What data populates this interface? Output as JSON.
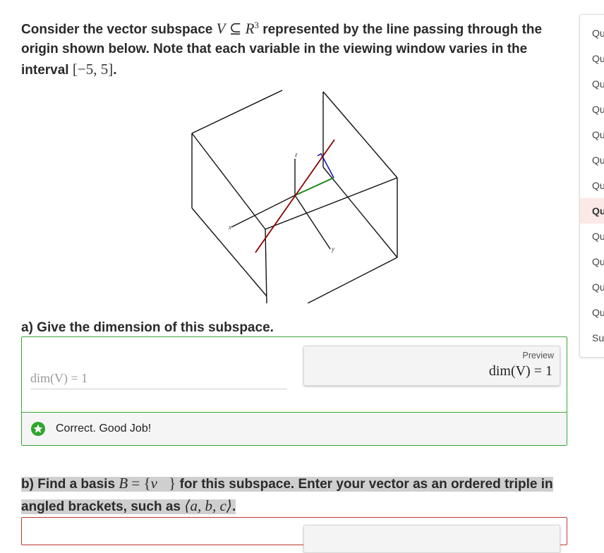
{
  "problem": {
    "t1": "Consider the vector subspace ",
    "m_V": "V",
    "m_subset": " ⊆ ",
    "m_R": "R",
    "m_exp": "3",
    "t2": " represented by the line passing through the origin shown below. Note that each variable in the viewing window varies in the interval ",
    "m_interval": "[−5, 5]",
    "t3": "."
  },
  "figure": {
    "axis_labels": {
      "x": "x",
      "y": "y",
      "z": "z"
    },
    "colors": {
      "frame": "#111111",
      "line": "#8b0000",
      "green": "#1a8a1a",
      "blue": "#1a1aa8"
    }
  },
  "part_a": {
    "label": "a) Give the dimension of this subspace.",
    "input_value": "dim(V) = 1",
    "preview_label": "Preview",
    "preview_value": "dim(V) = 1",
    "feedback": "Correct. Good Job!",
    "status_color": "#3aa53a"
  },
  "part_b": {
    "t1": "b) Find a basis ",
    "m_B": "B",
    "m_eq": " = {",
    "m_v": "v⃗",
    "m_close": "}",
    "t2": " for this subspace. Enter your vector as an ordered triple in angled brackets, such as ",
    "m_example": "⟨a, b, c⟩",
    "t3": ".",
    "status_color": "#c0392b"
  },
  "nav": {
    "items": [
      "Qu",
      "Qu",
      "Qu",
      "Qu",
      "Qu",
      "Qu",
      "Qu",
      "Qu",
      "Qu",
      "Qu",
      "Qu",
      "Qu",
      "Sur"
    ],
    "active_index": 7
  }
}
